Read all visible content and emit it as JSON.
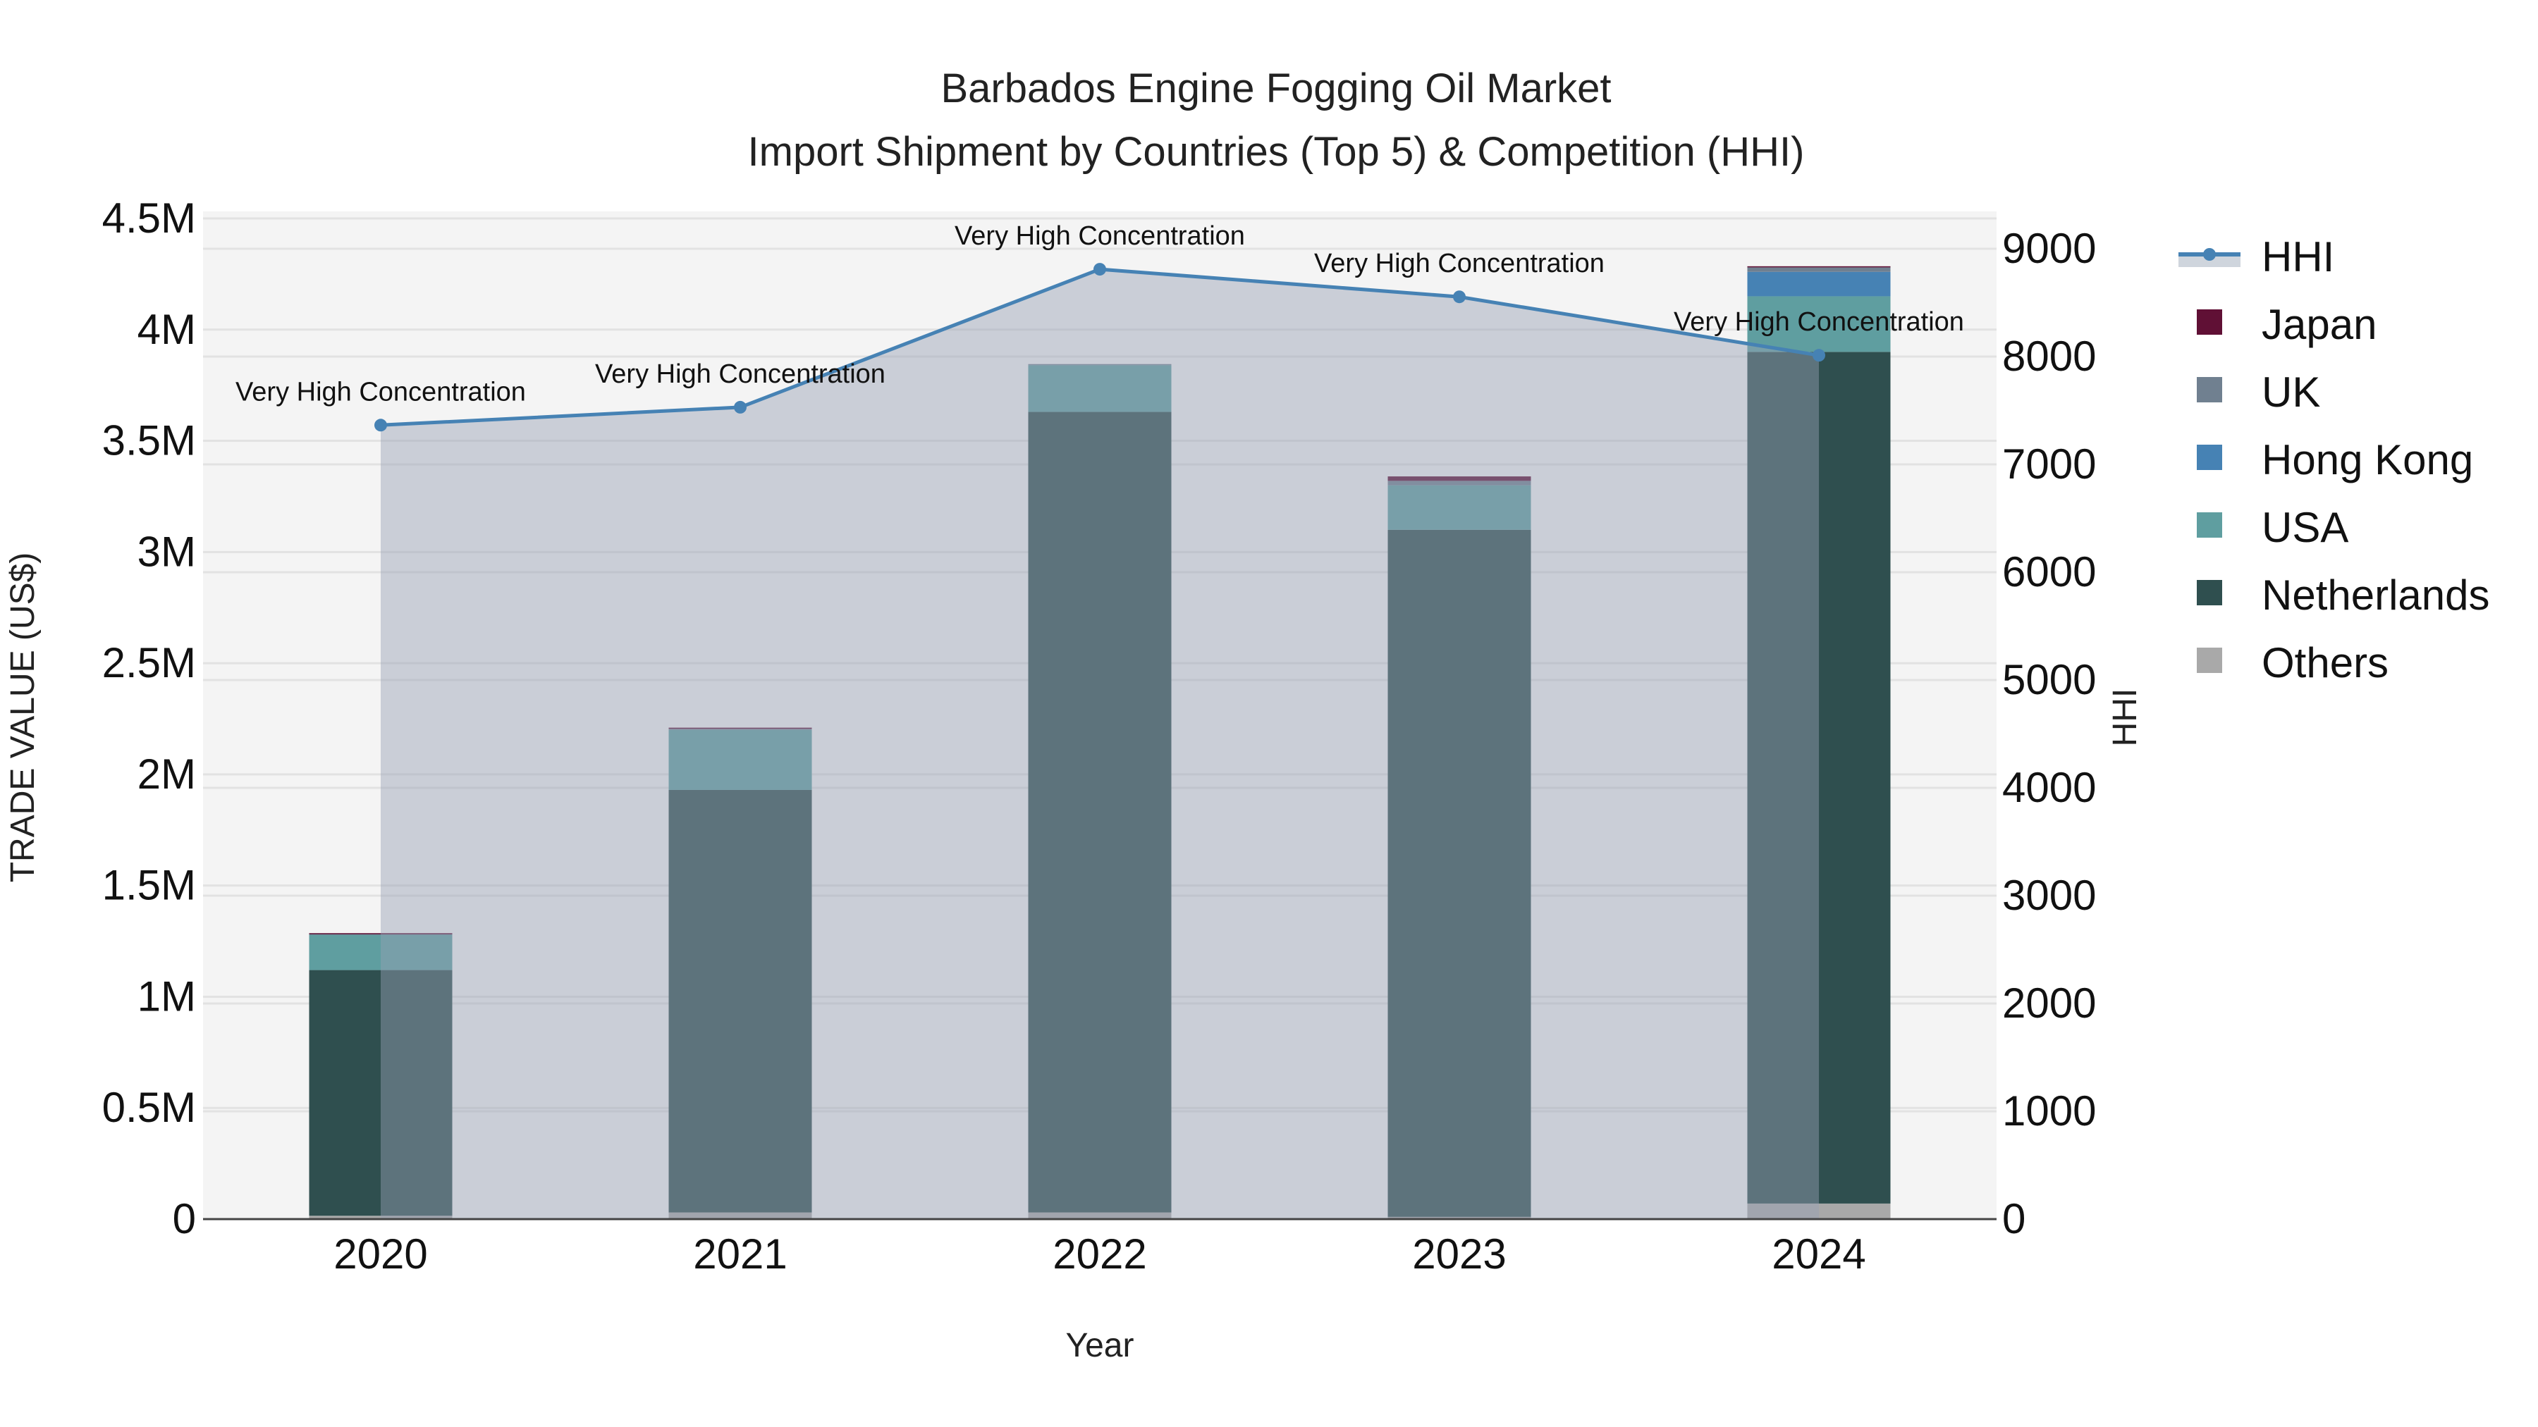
{
  "chart_data": {
    "type": "bar",
    "title": "Barbados Engine Fogging Oil Market",
    "subtitle": "Import Shipment by Countries (Top 5) & Competition (HHI)",
    "xlabel": "Year",
    "ylabel": "TRADE VALUE (US$)",
    "y2label": "HHI",
    "categories": [
      "2020",
      "2021",
      "2022",
      "2023",
      "2024"
    ],
    "ylim": [
      0,
      4500000
    ],
    "y_ticks": [
      0,
      500000,
      1000000,
      1500000,
      2000000,
      2500000,
      3000000,
      3500000,
      4000000,
      4500000
    ],
    "y_tick_labels": [
      "0",
      "0.5M",
      "1M",
      "1.5M",
      "2M",
      "2.5M",
      "3M",
      "3.5M",
      "4M",
      "4.5M"
    ],
    "y2_ticks": [
      0,
      1000,
      2000,
      3000,
      4000,
      5000,
      6000,
      7000,
      8000,
      9000
    ],
    "y2_tick_labels": [
      "0",
      "1000",
      "2000",
      "3000",
      "4000",
      "5000",
      "6000",
      "7000",
      "8000",
      "9000"
    ],
    "stacked": true,
    "series": [
      {
        "name": "Others",
        "color": "#a9a9a9",
        "values": [
          15000,
          30000,
          30000,
          10000,
          70000
        ]
      },
      {
        "name": "Netherlands",
        "color": "#2f4f4f",
        "values": [
          1105000,
          1900000,
          3600000,
          3090000,
          3830000
        ]
      },
      {
        "name": "USA",
        "color": "#5f9ea0",
        "values": [
          160000,
          270000,
          210000,
          200000,
          250000
        ]
      },
      {
        "name": "Hong Kong",
        "color": "#4682b4",
        "values": [
          0,
          0,
          0,
          0,
          110000
        ]
      },
      {
        "name": "UK",
        "color": "#708090",
        "values": [
          3000,
          5000,
          5000,
          20000,
          20000
        ]
      },
      {
        "name": "Japan",
        "color": "#601035",
        "values": [
          3000,
          5000,
          0,
          20000,
          5000
        ]
      }
    ],
    "line": {
      "name": "HHI",
      "color": "#4682b4",
      "values": [
        7364,
        7530,
        8810,
        8554,
        8012
      ],
      "annotations": [
        "Very High Concentration",
        "Very High Concentration",
        "Very High Concentration",
        "Very High Concentration",
        "Very High Concentration"
      ]
    },
    "legend": {
      "placement": "right",
      "entries": [
        "HHI",
        "Japan",
        "UK",
        "Hong Kong",
        "USA",
        "Netherlands",
        "Others"
      ]
    },
    "grid": true
  }
}
